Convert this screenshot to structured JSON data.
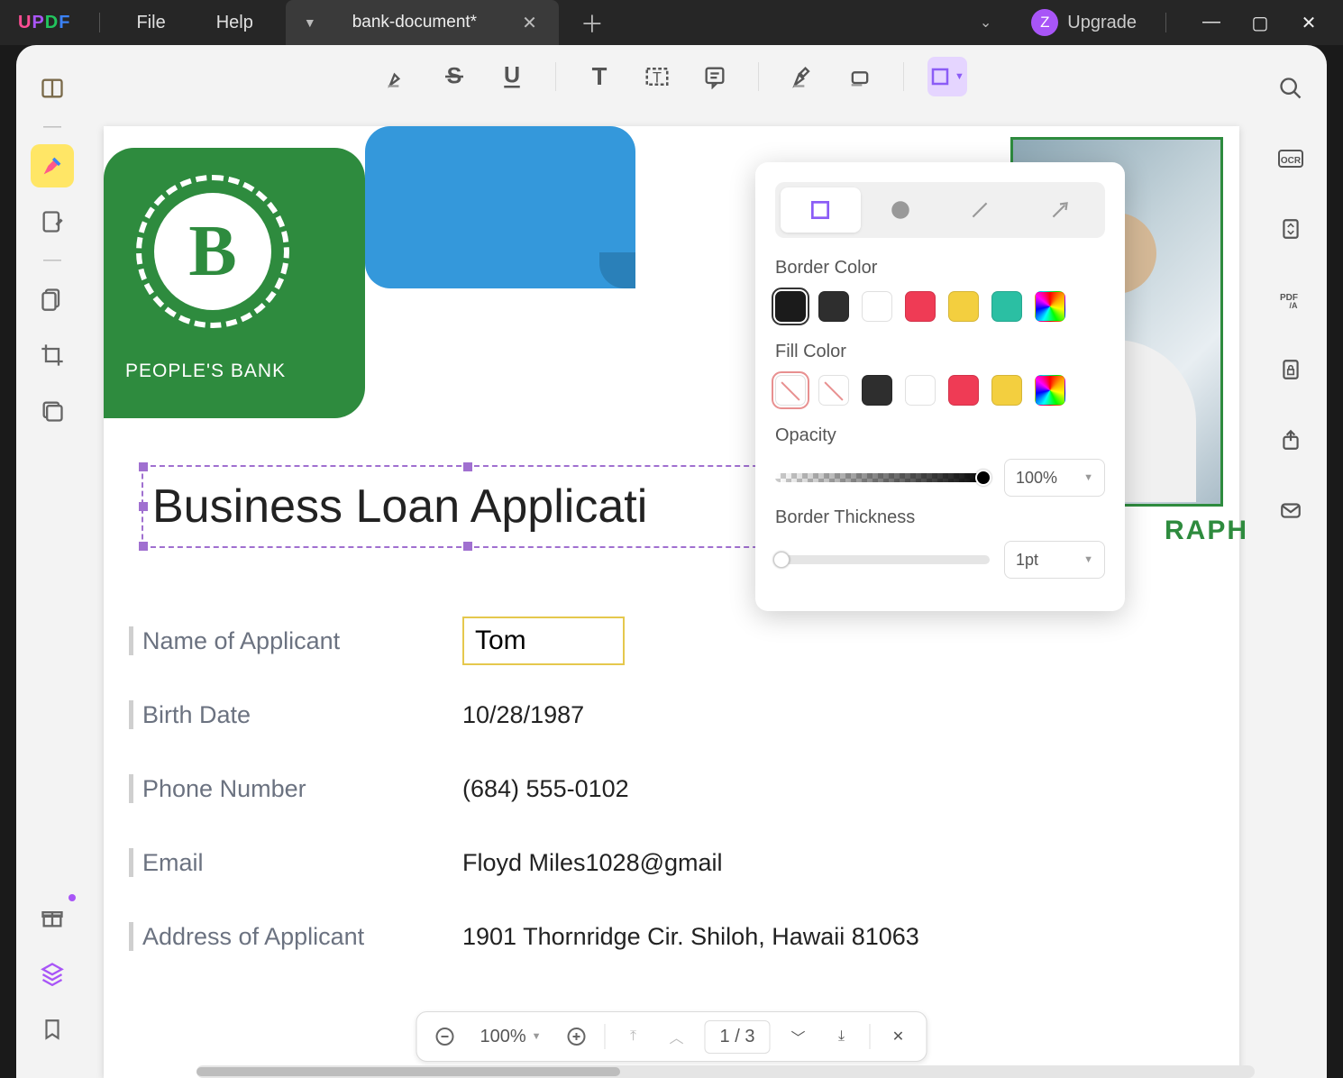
{
  "app": {
    "logo_text": "UPDF"
  },
  "menu": {
    "file": "File",
    "help": "Help"
  },
  "tab": {
    "title": "bank-document*"
  },
  "upgrade": {
    "initial": "Z",
    "label": "Upgrade"
  },
  "document": {
    "bank_logo_letter": "B",
    "bank_name": "PEOPLE'S BANK",
    "title": "Business Loan Applicati",
    "photo_caption_fragment": "RAPH",
    "fields": [
      {
        "label": "Name of Applicant",
        "value": "Tom",
        "is_input": true
      },
      {
        "label": "Birth Date",
        "value": "10/28/1987"
      },
      {
        "label": "Phone Number",
        "value": "(684) 555-0102"
      },
      {
        "label": "Email",
        "value": "Floyd Miles1028@gmail"
      },
      {
        "label": "Address of Applicant",
        "value": "1901 Thornridge Cir. Shiloh, Hawaii 81063"
      }
    ]
  },
  "popover": {
    "border_color_label": "Border Color",
    "fill_color_label": "Fill Color",
    "opacity_label": "Opacity",
    "opacity_value": "100%",
    "thickness_label": "Border Thickness",
    "thickness_value": "1pt",
    "border_colors": [
      "#1b1b1b",
      "#2e2e2e",
      "#ffffff",
      "#ef3b55",
      "#f3cf3f",
      "#2bbfa3",
      "rainbow"
    ],
    "fill_colors": [
      "none",
      "none-white",
      "#2e2e2e",
      "#ffffff",
      "#ef3b55",
      "#f3cf3f",
      "rainbow"
    ]
  },
  "pager": {
    "zoom": "100%",
    "page_current": "1",
    "page_sep": "/",
    "page_total": "3"
  }
}
